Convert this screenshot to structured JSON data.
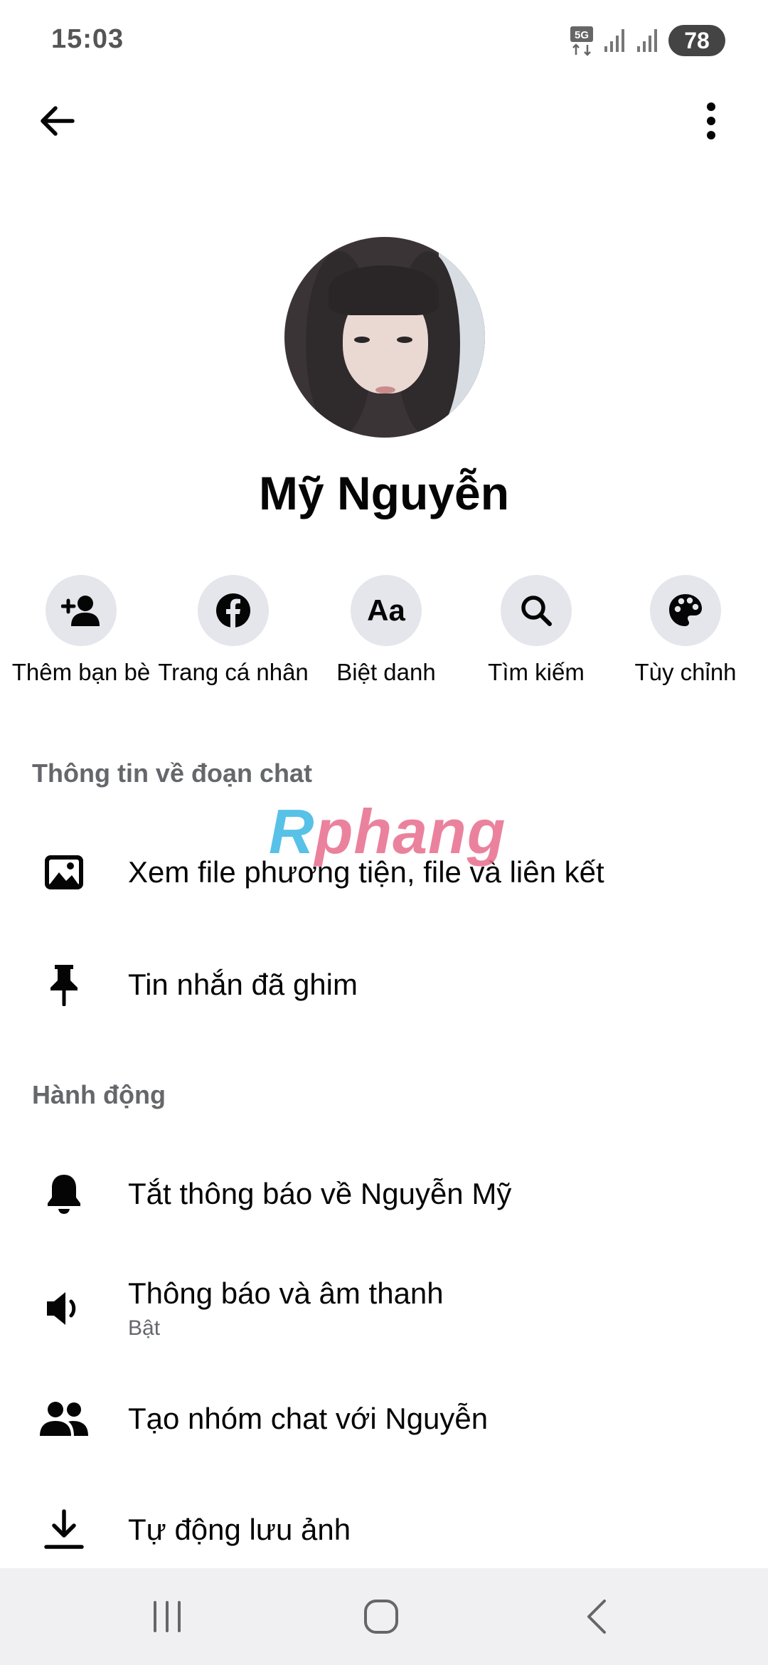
{
  "status_bar": {
    "time": "15:03",
    "network_label": "5G",
    "battery": "78"
  },
  "profile": {
    "name": "Mỹ Nguyễn"
  },
  "actions": [
    {
      "label": "Thêm bạn bè",
      "icon": "add-friend-icon"
    },
    {
      "label": "Trang cá nhân",
      "icon": "facebook-icon"
    },
    {
      "label": "Biệt danh",
      "icon": "nickname-icon",
      "glyph": "Aa"
    },
    {
      "label": "Tìm kiếm",
      "icon": "search-icon"
    },
    {
      "label": "Tùy chỉnh",
      "icon": "palette-icon"
    }
  ],
  "sections": {
    "chat_info": {
      "header": "Thông tin về đoạn chat",
      "items": [
        {
          "label": "Xem file phương tiện, file và liên kết",
          "icon": "image-icon"
        },
        {
          "label": "Tin nhắn đã ghim",
          "icon": "pin-icon"
        }
      ]
    },
    "actions": {
      "header": "Hành động",
      "items": [
        {
          "label": "Tắt thông báo về Nguyễn Mỹ",
          "icon": "bell-icon"
        },
        {
          "label": "Thông báo và âm thanh",
          "sublabel": "Bật",
          "icon": "speaker-icon"
        },
        {
          "label": "Tạo nhóm chat với Nguyễn",
          "icon": "group-icon"
        },
        {
          "label": "Tự động lưu ảnh",
          "icon": "download-icon"
        }
      ]
    }
  },
  "watermark": {
    "part1": "R",
    "part2": "phang"
  },
  "colors": {
    "icon_circle_bg": "#e4e6eb",
    "section_header": "#65676b",
    "nav_bar_bg": "#f0f0f2"
  }
}
